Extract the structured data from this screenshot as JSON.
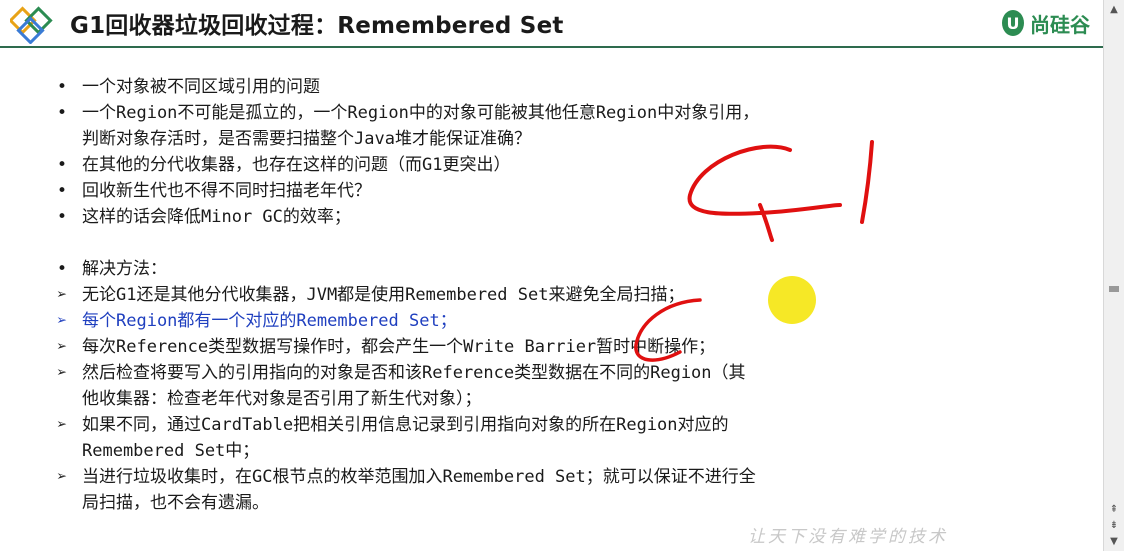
{
  "slide": {
    "title": "G1回收器垃圾回收过程：Remembered Set",
    "brand": {
      "mark": "U",
      "name": "尚硅谷"
    },
    "items": [
      {
        "marker": "•",
        "text": "一个对象被不同区域引用的问题"
      },
      {
        "marker": "•",
        "text": "一个Region不可能是孤立的，一个Region中的对象可能被其他任意Region中对象引用，\n判断对象存活时，是否需要扫描整个Java堆才能保证准确？"
      },
      {
        "marker": "•",
        "text": "在其他的分代收集器，也存在这样的问题（而G1更突出）"
      },
      {
        "marker": "•",
        "text": "回收新生代也不得不同时扫描老年代？"
      },
      {
        "marker": "•",
        "text": "这样的话会降低Minor GC的效率；"
      },
      {
        "marker": "•",
        "text": "解决方法："
      },
      {
        "marker": "➢",
        "text": "无论G1还是其他分代收集器，JVM都是使用Remembered Set来避免全局扫描；"
      },
      {
        "marker": "➢",
        "text": "每个Region都有一个对应的Remembered Set；"
      },
      {
        "marker": "➢",
        "text": "每次Reference类型数据写操作时，都会产生一个Write Barrier暂时中断操作；"
      },
      {
        "marker": "➢",
        "text": "然后检查将要写入的引用指向的对象是否和该Reference类型数据在不同的Region（其\n他收集器：检查老年代对象是否引用了新生代对象）；"
      },
      {
        "marker": "➢",
        "text": "如果不同，通过CardTable把相关引用信息记录到引用指向对象的所在Region对应的\nRemembered Set中；"
      },
      {
        "marker": "➢",
        "text": "当进行垃圾收集时，在GC根节点的枚举范围加入Remembered Set；就可以保证不进行全\n局扫描，也不会有遗漏。"
      }
    ],
    "watermark": "让天下没有难学的技术"
  },
  "colors": {
    "accent": "#2e6b4e",
    "brand": "#2c8c52",
    "highlight_item": "#1f3fbf",
    "annotation": "#e01010",
    "cursor_highlight": "#f5e400"
  }
}
